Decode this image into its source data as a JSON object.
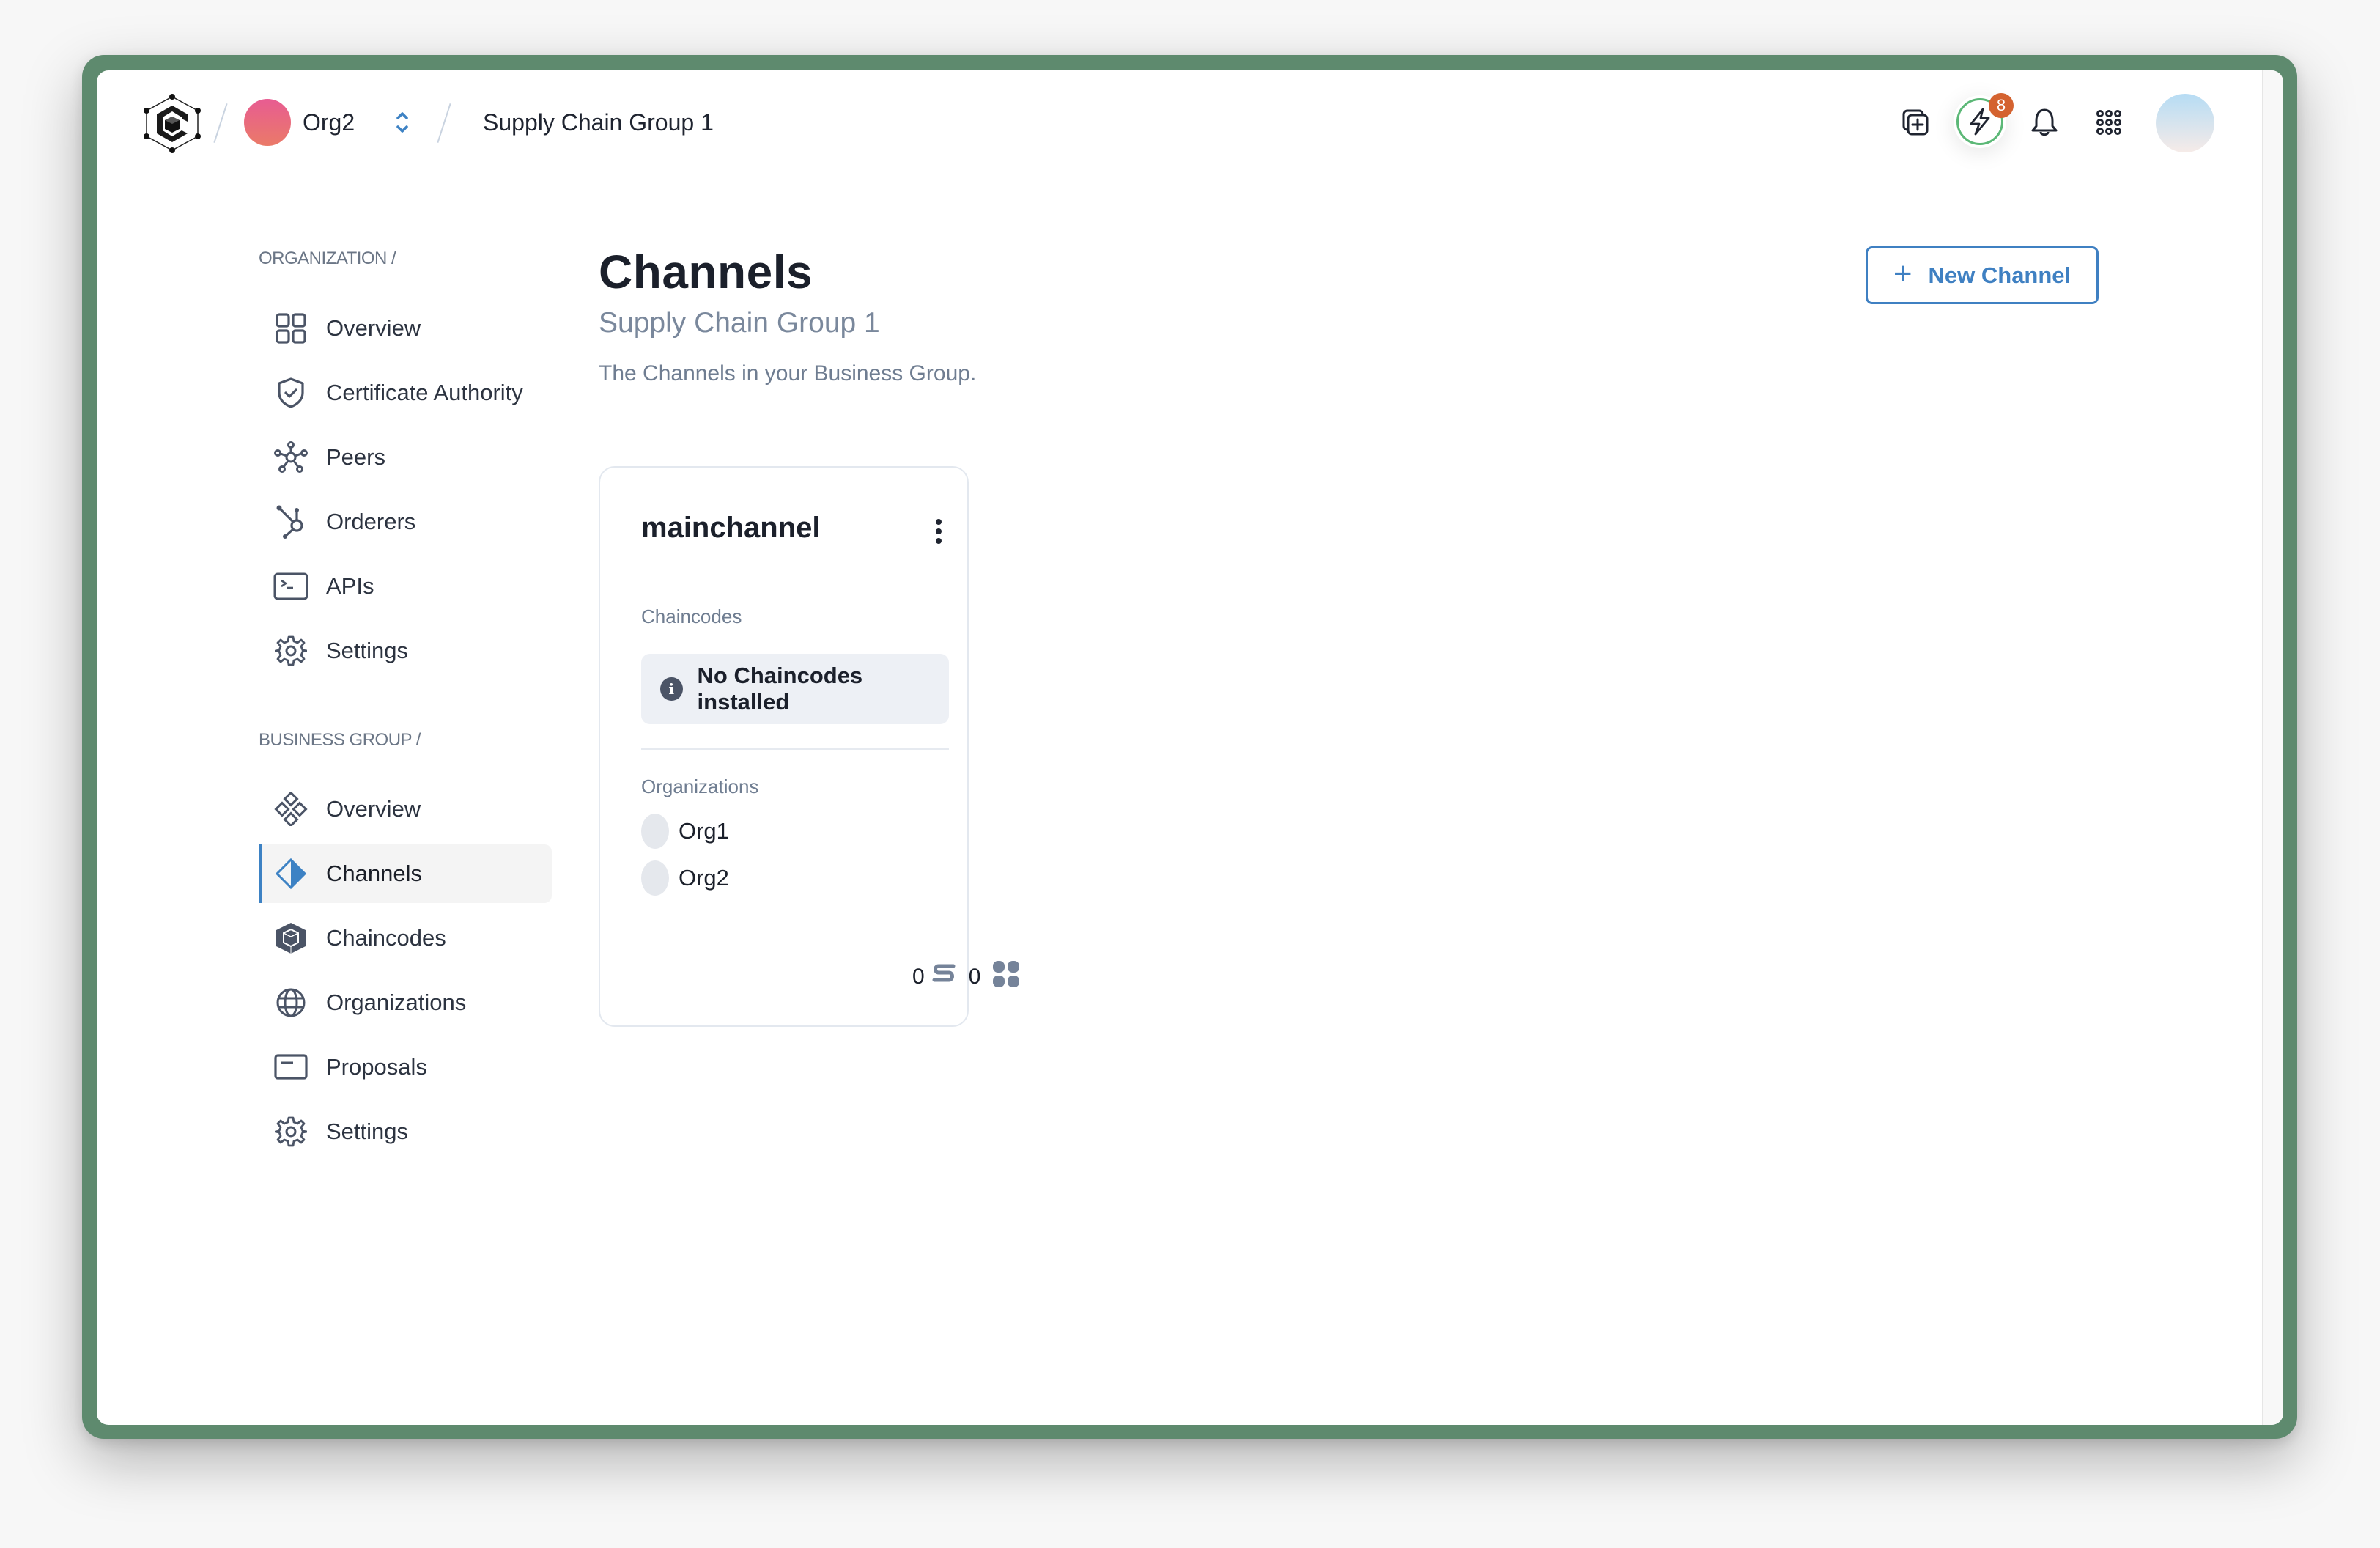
{
  "header": {
    "logo": "hexagon-cube-logo",
    "org_name": "Org2",
    "group_name": "Supply Chain Group 1",
    "notification_badge": "8",
    "icons": [
      "add-square-icon",
      "lightning-icon",
      "bell-icon",
      "apps-grid-icon",
      "user-avatar"
    ]
  },
  "sidebar": {
    "organization_section": {
      "label": "ORGANIZATION /",
      "items": [
        {
          "label": "Overview",
          "icon": "grid-icon"
        },
        {
          "label": "Certificate Authority",
          "icon": "shield-check-icon"
        },
        {
          "label": "Peers",
          "icon": "network-icon"
        },
        {
          "label": "Orderers",
          "icon": "hub-icon"
        },
        {
          "label": "APIs",
          "icon": "terminal-icon"
        },
        {
          "label": "Settings",
          "icon": "gear-icon"
        }
      ]
    },
    "business_group_section": {
      "label": "BUSINESS GROUP /",
      "items": [
        {
          "label": "Overview",
          "icon": "diamonds-icon"
        },
        {
          "label": "Channels",
          "icon": "half-diamond-icon",
          "active": true
        },
        {
          "label": "Chaincodes",
          "icon": "hexagon-cube-icon"
        },
        {
          "label": "Organizations",
          "icon": "globe-icon"
        },
        {
          "label": "Proposals",
          "icon": "card-icon"
        },
        {
          "label": "Settings",
          "icon": "gear-icon"
        }
      ]
    }
  },
  "main": {
    "title": "Channels",
    "subtitle": "Supply Chain Group 1",
    "description": "The Channels in your Business Group.",
    "new_button_label": "New Channel",
    "colors": {
      "accent": "#3f80c2",
      "frame": "#5e8a6e",
      "badge": "#d4622f",
      "ring": "#5cb877"
    },
    "channels": [
      {
        "name": "mainchannel",
        "chaincodes_label": "Chaincodes",
        "chaincodes_empty_message": "No Chaincodes installed",
        "organizations_label": "Organizations",
        "organizations": [
          "Org1",
          "Org2"
        ],
        "stats": {
          "transactions": "0",
          "blocks": "0"
        }
      }
    ]
  }
}
